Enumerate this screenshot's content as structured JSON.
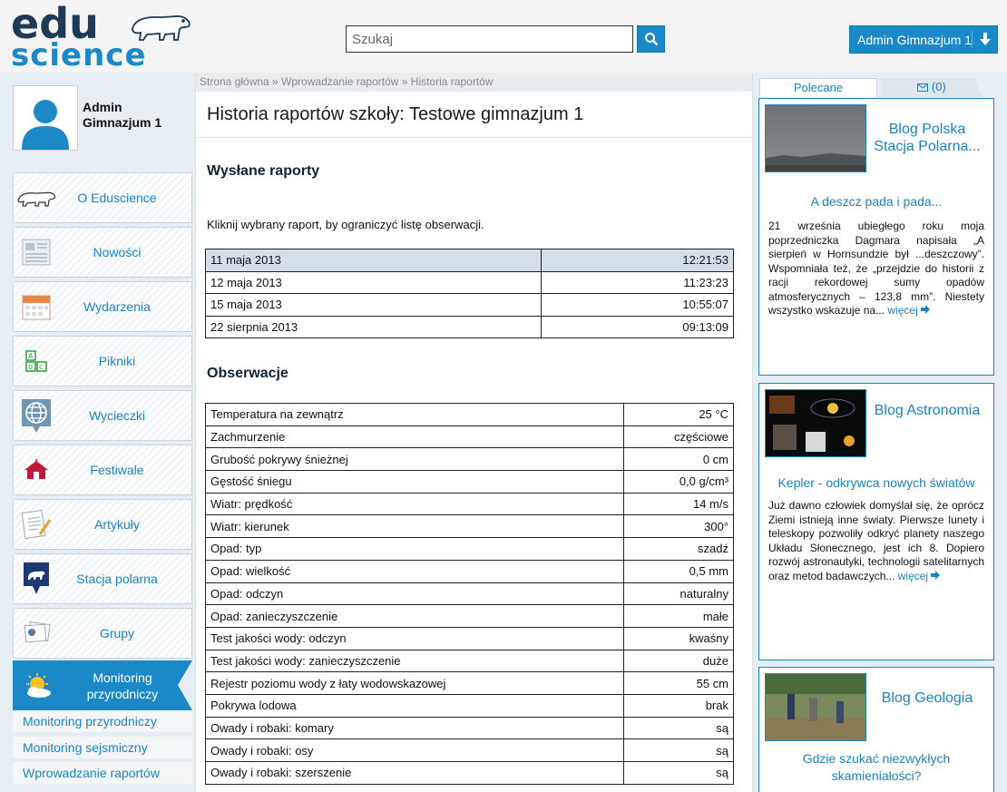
{
  "header": {
    "logo_top": "edu",
    "logo_bottom": "science",
    "search_placeholder": "Szukaj",
    "user_button": "Admin Gimnazjum 1"
  },
  "profile": {
    "name_line1": "Admin",
    "name_line2": "Gimnazjum 1"
  },
  "nav": {
    "items": [
      {
        "label": "O Eduscience",
        "icon": "polar-bear-icon"
      },
      {
        "label": "Nowości",
        "icon": "newspaper-icon"
      },
      {
        "label": "Wydarzenia",
        "icon": "calendar-icon"
      },
      {
        "label": "Pikniki",
        "icon": "blocks-icon"
      },
      {
        "label": "Wycieczki",
        "icon": "globe-icon"
      },
      {
        "label": "Festiwale",
        "icon": "tent-icon"
      },
      {
        "label": "Artykuły",
        "icon": "document-icon"
      },
      {
        "label": "Stacja polarna",
        "icon": "map-pin-bear-icon"
      },
      {
        "label": "Grupy",
        "icon": "papers-icon"
      }
    ],
    "active": {
      "label_line1": "Monitoring",
      "label_line2": "przyrodniczy",
      "icon": "sun-cloud-icon"
    },
    "sub_items": [
      "Monitoring przyrodniczy",
      "Monitoring sejsmiczny",
      "Wprowadzanie raportów"
    ]
  },
  "main": {
    "breadcrumb": "Strona główna » Wprowadzanie raportów » Historia raportów",
    "title": "Historia raportów szkoły: Testowe gimnazjum 1",
    "reports_heading": "Wysłane raporty",
    "hint": "Kliknij wybrany raport, by ograniczyć listę obserwacji.",
    "reports": [
      {
        "date": "11 maja 2013",
        "time": "12:21:53"
      },
      {
        "date": "12 maja 2013",
        "time": "11:23:23"
      },
      {
        "date": "15 maja 2013",
        "time": "10:55:07"
      },
      {
        "date": "22 sierpnia 2013",
        "time": "09:13:09"
      }
    ],
    "obs_heading": "Obserwacje",
    "observations": [
      {
        "name": "Temperatura na zewnątrz",
        "value": "25 °C"
      },
      {
        "name": "Zachmurzenie",
        "value": "częściowe"
      },
      {
        "name": "Grubość pokrywy śnieżnej",
        "value": "0 cm"
      },
      {
        "name": "Gęstość śniegu",
        "value": "0,0 g/cm³"
      },
      {
        "name": "Wiatr: prędkość",
        "value": "14 m/s"
      },
      {
        "name": "Wiatr: kierunek",
        "value": "300°"
      },
      {
        "name": "Opad: typ",
        "value": "szadź"
      },
      {
        "name": "Opad: wielkość",
        "value": "0,5 mm"
      },
      {
        "name": "Opad: odczyn",
        "value": "naturalny"
      },
      {
        "name": "Opad: zanieczyszczenie",
        "value": "małe"
      },
      {
        "name": "Test jakości wody: odczyn",
        "value": "kwaśny"
      },
      {
        "name": "Test jakości wody: zanieczyszczenie",
        "value": "duże"
      },
      {
        "name": "Rejestr poziomu wody z łaty wodowskazowej",
        "value": "55 cm"
      },
      {
        "name": "Pokrywa lodowa",
        "value": "brak"
      },
      {
        "name": "Owady i robaki: komary",
        "value": "są"
      },
      {
        "name": "Owady i robaki: osy",
        "value": "są"
      },
      {
        "name": "Owady i robaki: szerszenie",
        "value": "są"
      }
    ]
  },
  "right": {
    "tab_recommended": "Polecane",
    "tab_messages": "(0)",
    "more_label": "więcej",
    "cards": [
      {
        "blog": "Blog Polska Stacja Polarna...",
        "post_title": "A deszcz pada i pada...",
        "excerpt": "21 września ubiegłego roku moja poprzedniczka Dagmara napisała „A sierpień w Hornsundzie był ...deszczowy”. Wspomniała też, że „przejdzie do historii z racji rekordowej sumy opadów atmosferycznych – 123,8 mm”. Niestety wszystko wskazuje na..."
      },
      {
        "blog": "Blog Astronomia",
        "post_title": "Kepler - odkrywca nowych światów",
        "excerpt": "Już dawno człowiek domyślał się, że oprócz Ziemi istnieją inne światy. Pierwsze lunety i teleskopy pozwoliły odkryć planety naszego Układu Słonecznego, jest ich 8. Dopiero rozwój astronautyki, technologii satelitarnych oraz metod badawczych..."
      },
      {
        "blog": "Blog Geologia",
        "post_title": "Gdzie szukać niezwykłych skamieniałości?",
        "excerpt": ""
      }
    ]
  },
  "colors": {
    "accent": "#1b88c8",
    "link": "#1a83c3",
    "background": "#e6edf3"
  }
}
